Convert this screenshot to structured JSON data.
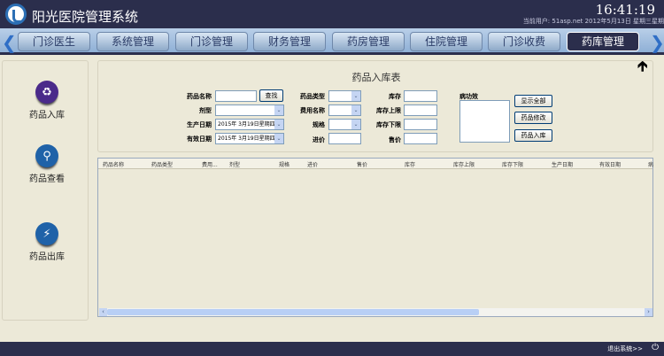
{
  "header": {
    "title": "阳光医院管理系统",
    "clock": "16:41:19",
    "user_line": "当前用户: 51asp.net  2012年5月13日 星期三星期"
  },
  "tabs": [
    "门诊医生",
    "系统管理",
    "门诊管理",
    "财务管理",
    "药房管理",
    "住院管理",
    "门诊收费",
    "药库管理"
  ],
  "active_tab": "药库管理",
  "sidebar": [
    {
      "label": "药品入库",
      "icon": "recycle-icon",
      "color": "#4a2a8a"
    },
    {
      "label": "药品查看",
      "icon": "search-icon",
      "color": "#1f62a8"
    },
    {
      "label": "药品出库",
      "icon": "lightning-icon",
      "color": "#1f62a8"
    }
  ],
  "form": {
    "title": "药品入库表",
    "labels": {
      "name": "药品名称",
      "dosage": "剂型",
      "prod_date": "生产日期",
      "exp_date": "有效日期",
      "type": "药品类型",
      "fee": "费用名称",
      "spec": "规格",
      "buy": "进价",
      "stock": "库存",
      "stock_max": "库存上限",
      "stock_min": "库存下限",
      "sell": "售价",
      "effect": "病功效"
    },
    "prod_date_value": "2015年  3月19日星期四",
    "exp_date_value": "2015年  3月19日星期四",
    "search_button": "查找",
    "buttons": [
      "显示全部",
      "药品修改",
      "药品入库"
    ]
  },
  "grid": {
    "columns": [
      "药品名称",
      "药品类型",
      "费用...",
      "剂型",
      "规格",
      "进价",
      "售价",
      "库存",
      "库存上限",
      "库存下限",
      "生产日期",
      "有效日期",
      "病"
    ]
  },
  "footer": {
    "logout": "退出系统>>"
  }
}
